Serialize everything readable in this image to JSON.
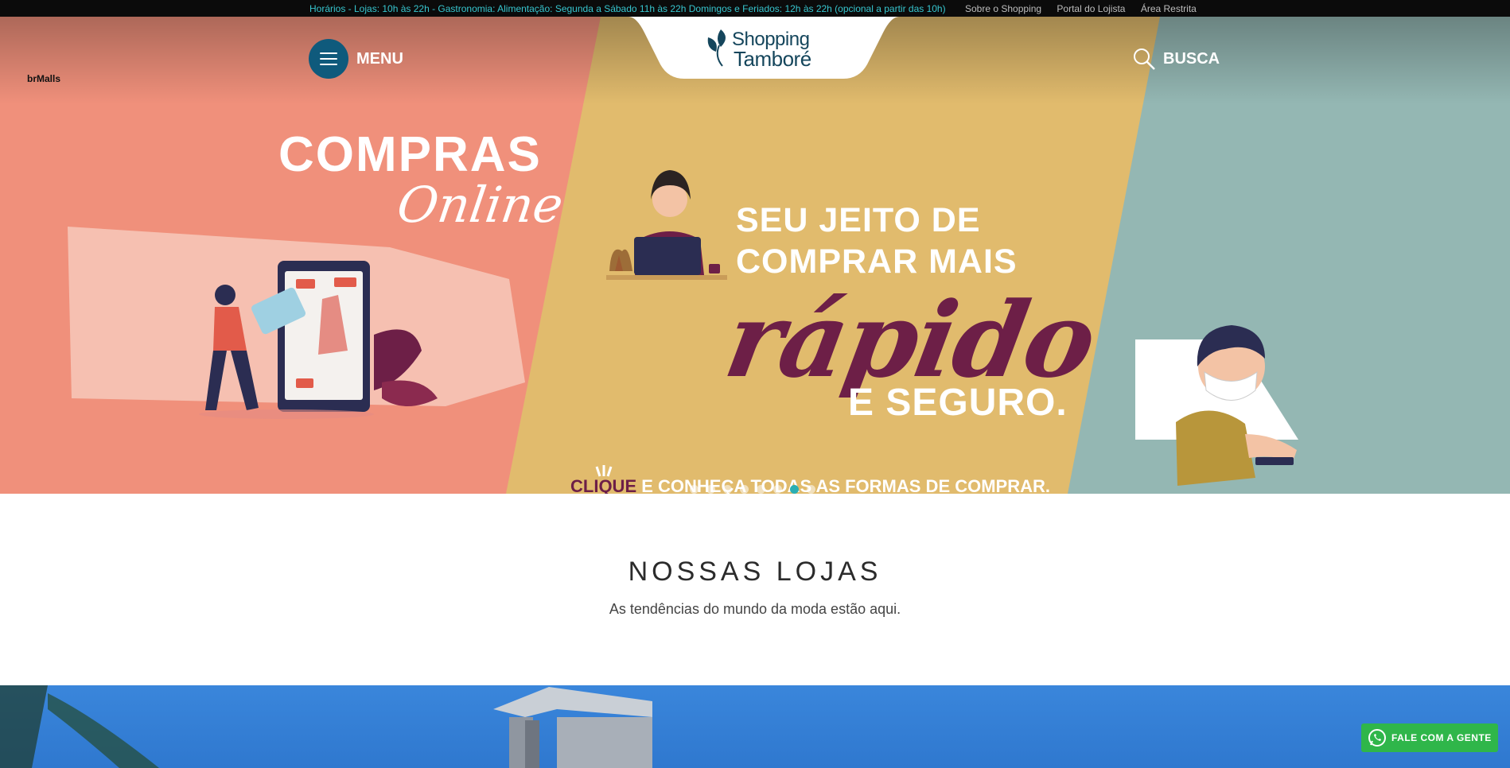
{
  "topbar": {
    "hours": "Horários - Lojas: 10h às 22h - Gastronomia: Alimentação: Segunda a Sábado 11h às 22h Domingos e Feriados: 12h às 22h (opcional a partir das 10h)",
    "links": [
      "Sobre o Shopping",
      "Portal do Lojista",
      "Área Restrita"
    ]
  },
  "header": {
    "brand_tag": "brMalls",
    "menu_label": "MENU",
    "logo_line1": "Shopping",
    "logo_line2": "Tamboré",
    "search_label": "BUSCA"
  },
  "banner": {
    "compras": "COMPRAS",
    "online": "Online",
    "seu_jeito_line1": "SEU JEITO DE",
    "seu_jeito_line2": "COMPRAR MAIS",
    "rapido": "rápido",
    "seguro": "E SEGURO.",
    "clique": "CLIQUE",
    "clique_rest": " E CONHEÇA TODAS AS FORMAS DE COMPRAR.",
    "slides": 8,
    "active_slide": 7
  },
  "section": {
    "title": "NOSSAS LOJAS",
    "subtitle": "As tendências do mundo da moda estão aqui."
  },
  "whatsapp": {
    "label": "FALE COM A GENTE"
  },
  "colors": {
    "topbar_bg": "#0b0b0b",
    "hours_text": "#37c6cf",
    "salmon": "#f0907b",
    "mustard": "#e1bb6d",
    "teal_grey": "#94b7b3",
    "plum": "#6d1f47",
    "menu_circle": "#0f5a7c",
    "whatsapp_green": "#2fb64a"
  }
}
